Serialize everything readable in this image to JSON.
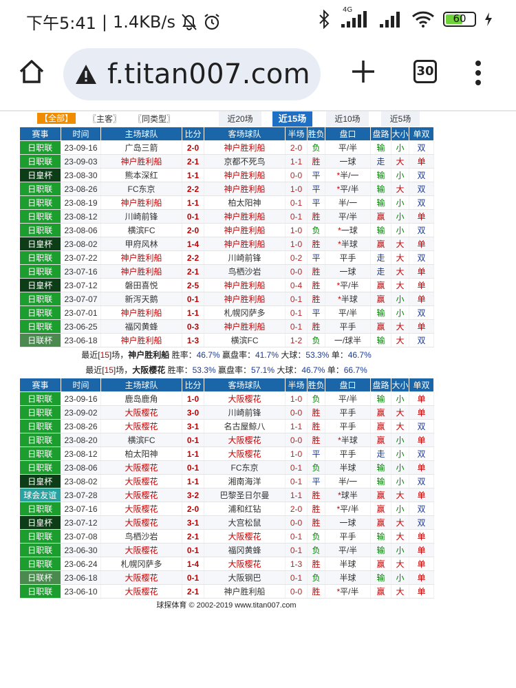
{
  "status_bar": {
    "time": "下午5:41",
    "speed": "1.4KB/s",
    "network": "4G",
    "battery": "60",
    "battery_level": 0.6
  },
  "browser": {
    "url": "f.titan007.com",
    "tab_count": "30"
  },
  "filters": {
    "all": "【全部】",
    "home": "〖主客〗",
    "same": "〖同类型〗",
    "buttons": [
      "近20场",
      "近15场",
      "近10场",
      "近5场"
    ],
    "active_button": 1
  },
  "headers": [
    "赛事",
    "时间",
    "主场球队",
    "比分",
    "客场球队",
    "半场",
    "胜负",
    "盘口",
    "盘路",
    "大小",
    "单双"
  ],
  "league_colors": {
    "日职联": "#1c9e2e",
    "日皇杯": "#0c3d16",
    "日联杯": "#4b8a4f",
    "球会友谊": "#2aa3a0"
  },
  "table1": [
    {
      "league": "日职联",
      "date": "23-09-16",
      "home": "广岛三箭",
      "score": "2-0",
      "away": "神户胜利船",
      "ht": "2-0",
      "result": "负",
      "handicap": "平/半",
      "hstar": false,
      "cover": "输",
      "ou": "小",
      "oe": "双",
      "focus": "away"
    },
    {
      "league": "日职联",
      "date": "23-09-03",
      "home": "神户胜利船",
      "score": "2-1",
      "away": "京都不死鸟",
      "ht": "1-1",
      "result": "胜",
      "handicap": "一球",
      "hstar": false,
      "cover": "走",
      "ou": "大",
      "oe": "单",
      "focus": "home"
    },
    {
      "league": "日皇杯",
      "date": "23-08-30",
      "home": "熊本深红",
      "score": "1-1",
      "away": "神户胜利船",
      "ht": "0-0",
      "result": "平",
      "handicap": "半/一",
      "hstar": true,
      "cover": "输",
      "ou": "小",
      "oe": "双",
      "focus": "away"
    },
    {
      "league": "日职联",
      "date": "23-08-26",
      "home": "FC东京",
      "score": "2-2",
      "away": "神户胜利船",
      "ht": "1-0",
      "result": "平",
      "handicap": "平/半",
      "hstar": true,
      "cover": "输",
      "ou": "大",
      "oe": "双",
      "focus": "away"
    },
    {
      "league": "日职联",
      "date": "23-08-19",
      "home": "神户胜利船",
      "score": "1-1",
      "away": "柏太阳神",
      "ht": "0-1",
      "result": "平",
      "handicap": "半/一",
      "hstar": false,
      "cover": "输",
      "ou": "小",
      "oe": "双",
      "focus": "home"
    },
    {
      "league": "日职联",
      "date": "23-08-12",
      "home": "川崎前锋",
      "score": "0-1",
      "away": "神户胜利船",
      "ht": "0-1",
      "result": "胜",
      "handicap": "平/半",
      "hstar": false,
      "cover": "赢",
      "ou": "小",
      "oe": "单",
      "focus": "away"
    },
    {
      "league": "日职联",
      "date": "23-08-06",
      "home": "横滨FC",
      "score": "2-0",
      "away": "神户胜利船",
      "ht": "1-0",
      "result": "负",
      "handicap": "一球",
      "hstar": true,
      "cover": "输",
      "ou": "小",
      "oe": "双",
      "focus": "away"
    },
    {
      "league": "日皇杯",
      "date": "23-08-02",
      "home": "甲府风林",
      "score": "1-4",
      "away": "神户胜利船",
      "ht": "1-0",
      "result": "胜",
      "handicap": "半球",
      "hstar": true,
      "cover": "赢",
      "ou": "大",
      "oe": "单",
      "focus": "away"
    },
    {
      "league": "日职联",
      "date": "23-07-22",
      "home": "神户胜利船",
      "score": "2-2",
      "away": "川崎前锋",
      "ht": "0-2",
      "result": "平",
      "handicap": "平手",
      "hstar": false,
      "cover": "走",
      "ou": "大",
      "oe": "双",
      "focus": "home"
    },
    {
      "league": "日职联",
      "date": "23-07-16",
      "home": "神户胜利船",
      "score": "2-1",
      "away": "鸟栖沙岩",
      "ht": "0-0",
      "result": "胜",
      "handicap": "一球",
      "hstar": false,
      "cover": "走",
      "ou": "大",
      "oe": "单",
      "focus": "home"
    },
    {
      "league": "日皇杯",
      "date": "23-07-12",
      "home": "磐田喜悦",
      "score": "2-5",
      "away": "神户胜利船",
      "ht": "0-4",
      "result": "胜",
      "handicap": "平/半",
      "hstar": true,
      "cover": "赢",
      "ou": "大",
      "oe": "单",
      "focus": "away"
    },
    {
      "league": "日职联",
      "date": "23-07-07",
      "home": "新泻天鹅",
      "score": "0-1",
      "away": "神户胜利船",
      "ht": "0-1",
      "result": "胜",
      "handicap": "半球",
      "hstar": true,
      "cover": "赢",
      "ou": "小",
      "oe": "单",
      "focus": "away"
    },
    {
      "league": "日职联",
      "date": "23-07-01",
      "home": "神户胜利船",
      "score": "1-1",
      "away": "札幌冈萨多",
      "ht": "0-1",
      "result": "平",
      "handicap": "平/半",
      "hstar": false,
      "cover": "输",
      "ou": "小",
      "oe": "双",
      "focus": "home"
    },
    {
      "league": "日职联",
      "date": "23-06-25",
      "home": "福冈黄蜂",
      "score": "0-3",
      "away": "神户胜利船",
      "ht": "0-1",
      "result": "胜",
      "handicap": "平手",
      "hstar": false,
      "cover": "赢",
      "ou": "大",
      "oe": "单",
      "focus": "away"
    },
    {
      "league": "日联杯",
      "date": "23-06-18",
      "home": "神户胜利船",
      "score": "1-3",
      "away": "横滨FC",
      "ht": "1-2",
      "result": "负",
      "handicap": "一/球半",
      "hstar": false,
      "cover": "输",
      "ou": "大",
      "oe": "双",
      "focus": "home"
    }
  ],
  "summary1": {
    "pre": "最近[",
    "n": "15",
    "mid": "]场，",
    "team": "神户胜利船",
    "win_label": " 胜率：",
    "win": "46.7%",
    "cover_label": " 赢盘率：",
    "cover": "41.7%",
    "big_label": " 大球：",
    "big": "53.3%",
    "odd_label": " 单：",
    "odd": "46.7%"
  },
  "summary2": {
    "pre": "最近[",
    "n": "15",
    "mid": "]场，",
    "team": "大阪樱花",
    "win_label": " 胜率：",
    "win": "53.3%",
    "cover_label": " 赢盘率：",
    "cover": "57.1%",
    "big_label": " 大球：",
    "big": "46.7%",
    "odd_label": " 单：",
    "odd": "66.7%"
  },
  "table2": [
    {
      "league": "日职联",
      "date": "23-09-16",
      "home": "鹿岛鹿角",
      "score": "1-0",
      "away": "大阪樱花",
      "ht": "1-0",
      "result": "负",
      "handicap": "平/半",
      "hstar": false,
      "cover": "输",
      "ou": "小",
      "oe": "单",
      "focus": "away"
    },
    {
      "league": "日职联",
      "date": "23-09-02",
      "home": "大阪樱花",
      "score": "3-0",
      "away": "川崎前锋",
      "ht": "0-0",
      "result": "胜",
      "handicap": "平手",
      "hstar": false,
      "cover": "赢",
      "ou": "大",
      "oe": "单",
      "focus": "home"
    },
    {
      "league": "日职联",
      "date": "23-08-26",
      "home": "大阪樱花",
      "score": "3-1",
      "away": "名古屋鲸八",
      "ht": "1-1",
      "result": "胜",
      "handicap": "平手",
      "hstar": false,
      "cover": "赢",
      "ou": "大",
      "oe": "双",
      "focus": "home"
    },
    {
      "league": "日职联",
      "date": "23-08-20",
      "home": "横滨FC",
      "score": "0-1",
      "away": "大阪樱花",
      "ht": "0-0",
      "result": "胜",
      "handicap": "半球",
      "hstar": true,
      "cover": "赢",
      "ou": "小",
      "oe": "单",
      "focus": "away"
    },
    {
      "league": "日职联",
      "date": "23-08-12",
      "home": "柏太阳神",
      "score": "1-1",
      "away": "大阪樱花",
      "ht": "1-0",
      "result": "平",
      "handicap": "平手",
      "hstar": false,
      "cover": "走",
      "ou": "小",
      "oe": "双",
      "focus": "away"
    },
    {
      "league": "日职联",
      "date": "23-08-06",
      "home": "大阪樱花",
      "score": "0-1",
      "away": "FC东京",
      "ht": "0-1",
      "result": "负",
      "handicap": "半球",
      "hstar": false,
      "cover": "输",
      "ou": "小",
      "oe": "单",
      "focus": "home"
    },
    {
      "league": "日皇杯",
      "date": "23-08-02",
      "home": "大阪樱花",
      "score": "1-1",
      "away": "湘南海洋",
      "ht": "0-1",
      "result": "平",
      "handicap": "半/一",
      "hstar": false,
      "cover": "输",
      "ou": "小",
      "oe": "双",
      "focus": "home"
    },
    {
      "league": "球会友谊",
      "date": "23-07-28",
      "home": "大阪樱花",
      "score": "3-2",
      "away": "巴黎圣日尔曼",
      "ht": "1-1",
      "result": "胜",
      "handicap": "球半",
      "hstar": true,
      "cover": "赢",
      "ou": "大",
      "oe": "单",
      "focus": "home"
    },
    {
      "league": "日职联",
      "date": "23-07-16",
      "home": "大阪樱花",
      "score": "2-0",
      "away": "浦和红钻",
      "ht": "2-0",
      "result": "胜",
      "handicap": "平/半",
      "hstar": true,
      "cover": "赢",
      "ou": "小",
      "oe": "双",
      "focus": "home"
    },
    {
      "league": "日皇杯",
      "date": "23-07-12",
      "home": "大阪樱花",
      "score": "3-1",
      "away": "大宫松鼠",
      "ht": "0-0",
      "result": "胜",
      "handicap": "一球",
      "hstar": false,
      "cover": "赢",
      "ou": "大",
      "oe": "双",
      "focus": "home"
    },
    {
      "league": "日职联",
      "date": "23-07-08",
      "home": "鸟栖沙岩",
      "score": "2-1",
      "away": "大阪樱花",
      "ht": "0-1",
      "result": "负",
      "handicap": "平手",
      "hstar": false,
      "cover": "输",
      "ou": "大",
      "oe": "单",
      "focus": "away"
    },
    {
      "league": "日职联",
      "date": "23-06-30",
      "home": "大阪樱花",
      "score": "0-1",
      "away": "福冈黄蜂",
      "ht": "0-1",
      "result": "负",
      "handicap": "平/半",
      "hstar": false,
      "cover": "输",
      "ou": "小",
      "oe": "单",
      "focus": "home"
    },
    {
      "league": "日职联",
      "date": "23-06-24",
      "home": "札幌冈萨多",
      "score": "1-4",
      "away": "大阪樱花",
      "ht": "1-3",
      "result": "胜",
      "handicap": "半球",
      "hstar": false,
      "cover": "赢",
      "ou": "大",
      "oe": "单",
      "focus": "away"
    },
    {
      "league": "日联杯",
      "date": "23-06-18",
      "home": "大阪樱花",
      "score": "0-1",
      "away": "大阪钢巴",
      "ht": "0-1",
      "result": "负",
      "handicap": "半球",
      "hstar": false,
      "cover": "输",
      "ou": "小",
      "oe": "单",
      "focus": "home"
    },
    {
      "league": "日职联",
      "date": "23-06-10",
      "home": "大阪樱花",
      "score": "2-1",
      "away": "神户胜利船",
      "ht": "0-0",
      "result": "胜",
      "handicap": "平/半",
      "hstar": true,
      "cover": "赢",
      "ou": "大",
      "oe": "单",
      "focus": "home"
    }
  ],
  "footer": "球探体育 © 2002-2019 www.titan007.com"
}
